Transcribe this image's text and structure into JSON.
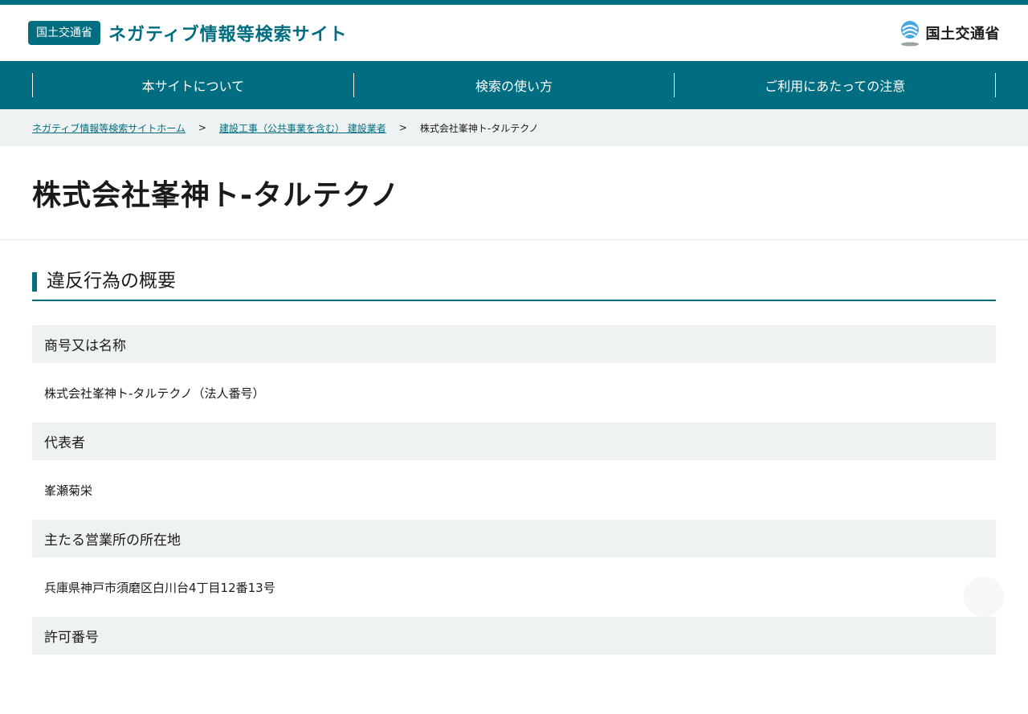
{
  "header": {
    "badge": "国土交通省",
    "site_title": "ネガティブ情報等検索サイト",
    "ministry_name": "国土交通省"
  },
  "nav": {
    "items": [
      {
        "label": "本サイトについて"
      },
      {
        "label": "検索の使い方"
      },
      {
        "label": "ご利用にあたっての注意"
      }
    ]
  },
  "breadcrumb": {
    "home": "ネガティブ情報等検索サイトホーム",
    "category": "建設工事（公共事業を含む） 建設業者",
    "current": "株式会社峯神ト-タルテクノ",
    "separator": ">"
  },
  "page": {
    "title": "株式会社峯神ト-タルテクノ"
  },
  "section": {
    "title": "違反行為の概要"
  },
  "fields": [
    {
      "label": "商号又は名称",
      "value": "株式会社峯神ト-タルテクノ（法人番号）"
    },
    {
      "label": "代表者",
      "value": "峯瀬菊栄"
    },
    {
      "label": "主たる営業所の所在地",
      "value": "兵庫県神戸市須磨区白川台4丁目12番13号"
    },
    {
      "label": "許可番号",
      "value": ""
    }
  ],
  "colors": {
    "primary": "#006d80",
    "light_bg": "#eff2f3"
  }
}
